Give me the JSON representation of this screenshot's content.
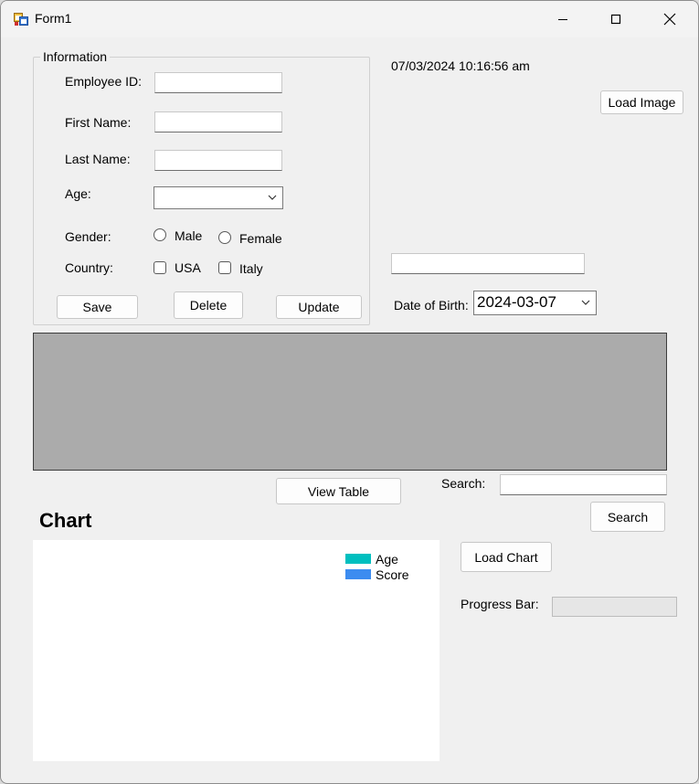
{
  "window": {
    "title": "Form1"
  },
  "info_group": {
    "legend": "Information",
    "employee_id": {
      "label": "Employee ID:",
      "value": ""
    },
    "first_name": {
      "label": "First Name:",
      "value": ""
    },
    "last_name": {
      "label": "Last Name:",
      "value": ""
    },
    "age": {
      "label": "Age:",
      "value": ""
    },
    "gender": {
      "label": "Gender:",
      "options": [
        "Male",
        "Female"
      ]
    },
    "country": {
      "label": "Country:",
      "options": [
        "USA",
        "Italy"
      ]
    },
    "buttons": {
      "save": "Save",
      "delete": "Delete",
      "update": "Update"
    }
  },
  "timestamp": "07/03/2024 10:16:56 am",
  "load_image_button": "Load Image",
  "image_path_value": "",
  "date_of_birth": {
    "label": "Date of Birth:",
    "value": "2024-03-07"
  },
  "view_table_button": "View Table",
  "search": {
    "label": "Search:",
    "value": "",
    "button": "Search"
  },
  "chart": {
    "heading": "Chart",
    "legend": [
      {
        "name": "Age",
        "color": "#00bfbf"
      },
      {
        "name": "Score",
        "color": "#3c8cf0"
      }
    ]
  },
  "chart_data": {
    "type": "bar",
    "categories": [],
    "series": [
      {
        "name": "Age",
        "values": []
      },
      {
        "name": "Score",
        "values": []
      }
    ]
  },
  "load_chart_button": "Load Chart",
  "progress_bar": {
    "label": "Progress Bar:",
    "value": 0
  }
}
